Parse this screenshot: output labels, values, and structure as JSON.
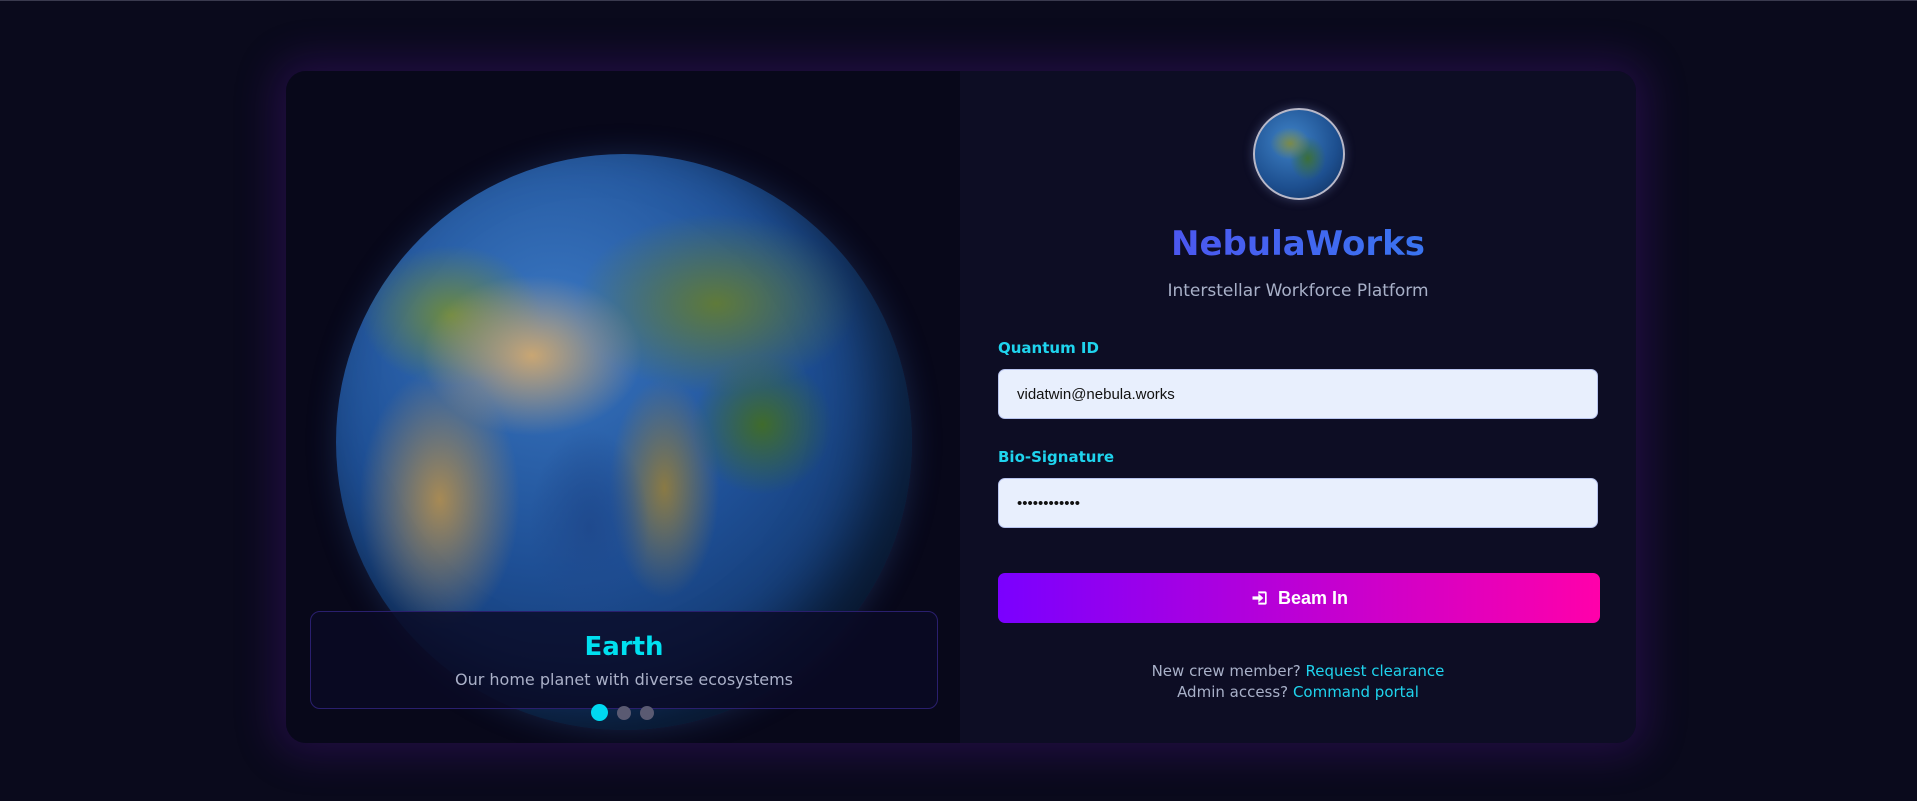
{
  "slide": {
    "title": "Earth",
    "subtitle": "Our home planet with diverse ecosystems",
    "active_index": 0,
    "count": 3
  },
  "brand": {
    "name": "NebulaWorks",
    "tagline": "Interstellar Workforce Platform"
  },
  "form": {
    "id_label": "Quantum ID",
    "id_value": "vidatwin@nebula.works",
    "password_label": "Bio-Signature",
    "password_value": "••••••••••••",
    "submit_label": "Beam In"
  },
  "footer": {
    "signup_prompt": "New crew member?",
    "signup_link": "Request clearance",
    "admin_prompt": "Admin access?",
    "admin_link": "Command portal"
  },
  "colors": {
    "accent": "#1fd4ee",
    "button_start": "#7a00ff",
    "button_end": "#ff00aa",
    "background": "#0a0a1c"
  },
  "icons": {
    "submit": "sign-in-icon",
    "logo": "globe-logo-icon"
  }
}
